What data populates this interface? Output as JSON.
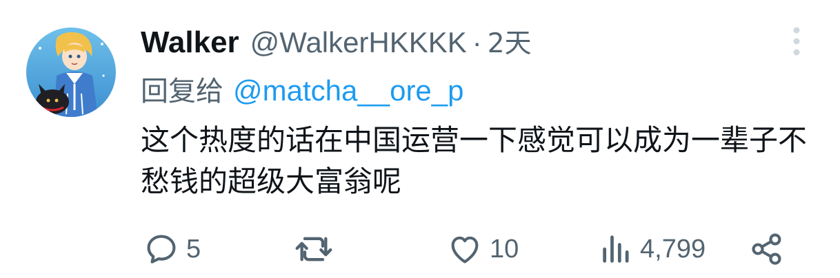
{
  "author": {
    "display_name": "Walker",
    "handle": "@WalkerHKKKK",
    "separator": "·",
    "time": "2天"
  },
  "reply": {
    "prefix": "回复给",
    "mention": "@matcha__ore_p"
  },
  "body": {
    "text": "这个热度的话在中国运营一下感觉可以成为一辈子不愁钱的超级大富翁呢"
  },
  "actions": {
    "reply_count": "5",
    "retweet_count": "",
    "like_count": "10",
    "views_count": "4,799"
  },
  "icons": {
    "more": "more-vertical-icon",
    "reply": "reply-icon",
    "retweet": "retweet-icon",
    "like": "heart-icon",
    "views": "views-icon",
    "share": "share-icon"
  },
  "colors": {
    "text_primary": "#0f1419",
    "text_secondary": "#536471",
    "link": "#1d9bf0",
    "more_dots": "#cfd9de"
  }
}
